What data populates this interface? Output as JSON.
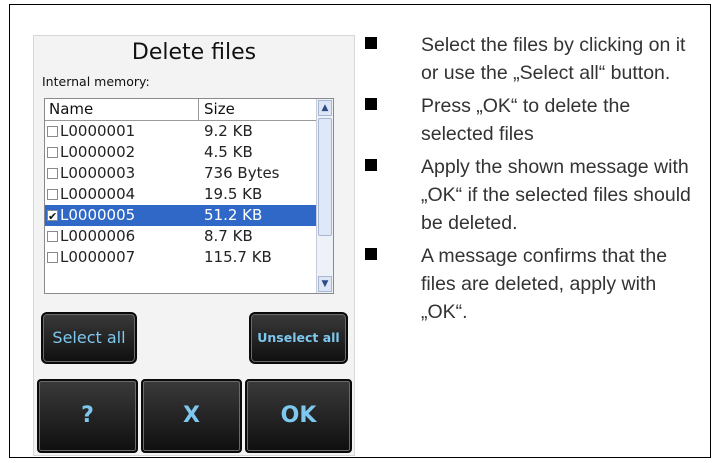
{
  "dialog": {
    "title": "Delete files",
    "subtitle": "Internal memory:",
    "columns": {
      "name": "Name",
      "size": "Size"
    },
    "rows": [
      {
        "name": "L0000001",
        "size": "9.2 KB",
        "checked": false,
        "selected": false
      },
      {
        "name": "L0000002",
        "size": "4.5 KB",
        "checked": false,
        "selected": false
      },
      {
        "name": "L0000003",
        "size": "736 Bytes",
        "checked": false,
        "selected": false
      },
      {
        "name": "L0000004",
        "size": "19.5 KB",
        "checked": false,
        "selected": false
      },
      {
        "name": "L0000005",
        "size": "51.2 KB",
        "checked": true,
        "selected": true
      },
      {
        "name": "L0000006",
        "size": "8.7 KB",
        "checked": false,
        "selected": false
      },
      {
        "name": "L0000007",
        "size": "115.7 KB",
        "checked": false,
        "selected": false
      }
    ],
    "buttons": {
      "select_all": "Select all",
      "unselect_all": "Unselect all",
      "help": "?",
      "cancel": "X",
      "ok": "OK"
    },
    "icons": {
      "scroll_up": "chevron-up-icon",
      "scroll_down": "chevron-down-icon",
      "checkbox_checked": "checkmark-icon"
    },
    "colors": {
      "selection": "#2f68c6",
      "button_text": "#7ec8f0",
      "button_bg": "#1a1a1a"
    }
  },
  "instructions": [
    "Select the files by clicking on it or use the „Select all“ button.",
    "Press „OK“ to delete the selected files",
    "Apply the shown message with „OK“ if the selected files should be deleted.",
    "A message confirms that the files are deleted, apply with „OK“."
  ]
}
